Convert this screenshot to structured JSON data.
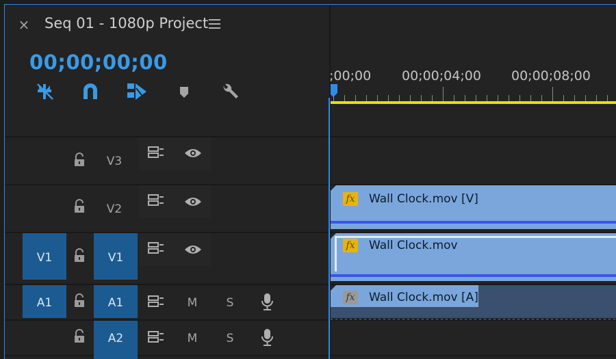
{
  "panel": {
    "title": "Seq 01 - 1080p Project",
    "close_glyph": "×",
    "timecode": "00;00;00;00"
  },
  "ruler": {
    "labels": [
      ";00;00",
      "00;00;04;00",
      "00;00;08;00"
    ]
  },
  "toolbar": {
    "icons": [
      "snap-nest-icon",
      "magnet-icon",
      "linked-selection-icon",
      "marker-icon",
      "wrench-icon"
    ]
  },
  "tracks": {
    "video": [
      {
        "name": "V3",
        "source_patch": "",
        "targeted": false
      },
      {
        "name": "V2",
        "source_patch": "",
        "targeted": false
      },
      {
        "name": "V1",
        "source_patch": "V1",
        "targeted": true
      }
    ],
    "audio": [
      {
        "name": "A1",
        "source_patch": "A1",
        "targeted": true,
        "mute": "M",
        "solo": "S"
      },
      {
        "name": "A2",
        "source_patch": "",
        "targeted": true,
        "mute": "M",
        "solo": "S"
      }
    ]
  },
  "clips": {
    "v2": {
      "label": "Wall Clock.mov [V]",
      "fx": "fx"
    },
    "v1": {
      "label": "Wall Clock.mov",
      "fx": "fx"
    },
    "a1": {
      "label": "Wall Clock.mov [A]",
      "fx": "fx"
    }
  },
  "colors": {
    "accent": "#2d8ceb",
    "timecode": "#3a9ae6",
    "clip_video": "#7aa6dc",
    "clip_audio": "#3a506e",
    "work_area": "#e4e400",
    "target_blue": "#1c5b91"
  }
}
